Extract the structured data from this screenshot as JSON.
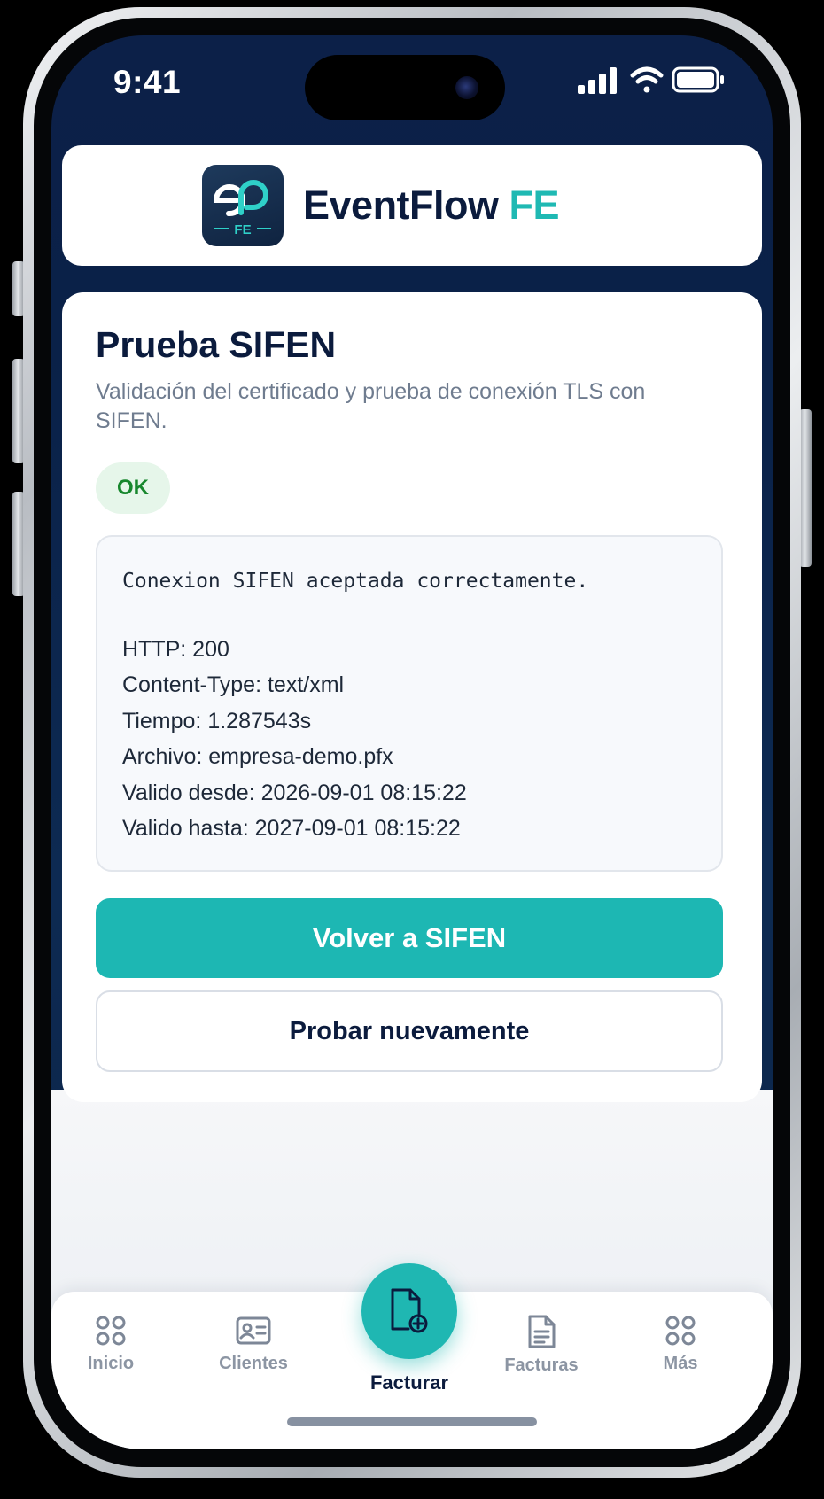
{
  "status_bar": {
    "time": "9:41"
  },
  "header": {
    "brand_name": "EventFlow",
    "brand_suffix": "FE",
    "logo_badge": "FE",
    "accent_color": "#1fb9b3"
  },
  "main": {
    "title": "Prueba SIFEN",
    "subtitle": "Validación del certificado y prueba de conexión TLS con SIFEN.",
    "status_badge": "OK",
    "result": {
      "message": "Conexion SIFEN aceptada correctamente.",
      "http": "HTTP: 200",
      "content_type": "Content-Type: text/xml",
      "time": "Tiempo: 1.287543s",
      "file": "Archivo: empresa-demo.pfx",
      "valid_from": "Valido desde: 2026-09-01 08:15:22",
      "valid_to": "Valido hasta: 2027-09-01 08:15:22"
    },
    "primary_button": "Volver a SIFEN",
    "secondary_button": "Probar nuevamente"
  },
  "tab_bar": {
    "items": [
      {
        "label": "Inicio",
        "icon": "grid-icon"
      },
      {
        "label": "Clientes",
        "icon": "id-card-icon"
      },
      {
        "label": "Facturar",
        "icon": "add-document-icon",
        "active": true
      },
      {
        "label": "Facturas",
        "icon": "document-icon"
      },
      {
        "label": "Más",
        "icon": "grid-icon"
      }
    ]
  }
}
